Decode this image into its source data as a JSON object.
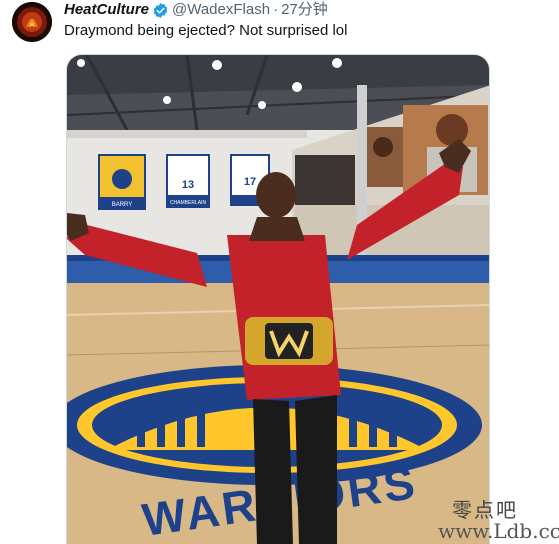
{
  "tweet": {
    "author_name": "HeatCulture",
    "handle": "@WadexFlash",
    "separator": "·",
    "timestamp": "27分钟",
    "text": "Draymond being ejected? Not surprised lol",
    "verified": true
  },
  "media": {
    "banners": [
      {
        "top": "",
        "number": "",
        "name": "BARRY"
      },
      {
        "top": "",
        "number": "13",
        "name": "CHAMBERLAIN"
      },
      {
        "top": "",
        "number": "17",
        "name": ""
      }
    ],
    "court_text": "WARRIORS"
  },
  "watermark": {
    "chinese": "零点吧",
    "url": "www.Ldb.cc"
  },
  "colors": {
    "verified_blue": "#1d9bf0",
    "text_primary": "#0f1419",
    "text_secondary": "#536471",
    "warriors_blue": "#1d428a",
    "warriors_gold": "#ffc72c"
  }
}
